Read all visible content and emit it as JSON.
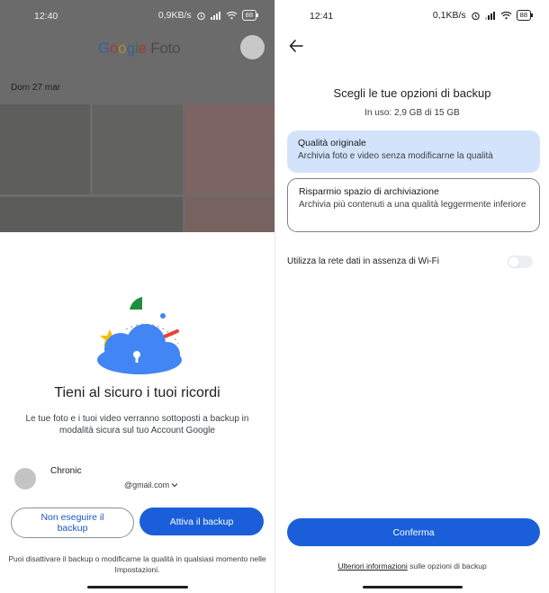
{
  "left": {
    "status": {
      "time": "12:40",
      "speed": "0,9KB/s",
      "battery": "88"
    },
    "app": {
      "logo_google": [
        "G",
        "o",
        "o",
        "g",
        "l",
        "e"
      ],
      "logo_product": "Foto"
    },
    "date_header": "Dom 27 mar",
    "sheet": {
      "title": "Tieni al sicuro i tuoi ricordi",
      "description": "Le tue foto e i tuoi video verranno sottoposti a backup in modalità sicura sul tuo Account Google",
      "account_name": "Chronic",
      "account_email": "@gmail.com",
      "skip_button": "Non eseguire il backup",
      "enable_button": "Attiva il backup",
      "footer": "Puoi disattivare il backup o modificarne la qualità in qualsiasi momento nelle Impostazioni."
    }
  },
  "right": {
    "status": {
      "time": "12:41",
      "speed": "0,1KB/s",
      "battery": "88"
    },
    "title": "Scegli le tue opzioni di backup",
    "usage": "In uso: 2,9 GB di 15 GB",
    "options": [
      {
        "title": "Qualità originale",
        "description": "Archivia foto e video senza modificarne la qualità",
        "selected": true
      },
      {
        "title": "Risparmio spazio di archiviazione",
        "description": "Archivia più contenuti a una qualità leggermente inferiore",
        "selected": false
      }
    ],
    "mobile_data_label": "Utilizza la rete dati in assenza di Wi-Fi",
    "mobile_data_enabled": false,
    "confirm_button": "Conferma",
    "footer_link": "Ulteriori informazioni",
    "footer_rest": " sulle opzioni di backup"
  },
  "colors": {
    "primary": "#1a5fd9",
    "selected_option": "#d4e3fc",
    "scrim": "#6b6b6b"
  }
}
